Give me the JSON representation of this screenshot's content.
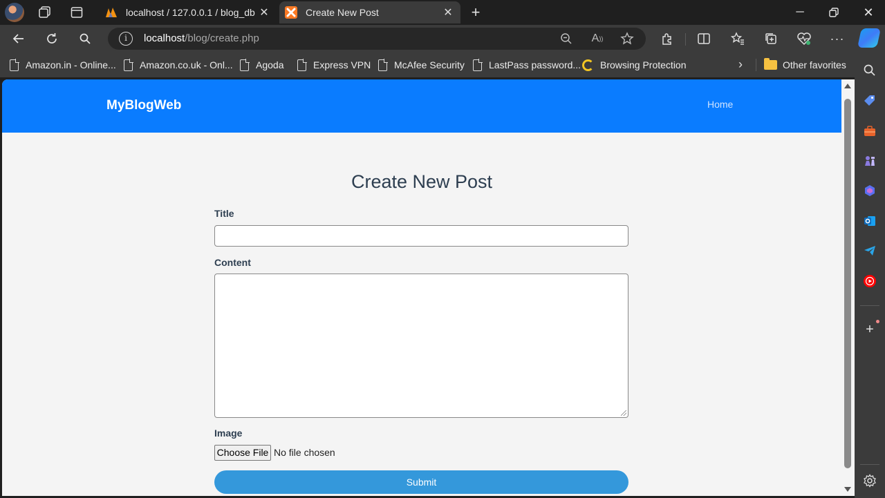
{
  "browser": {
    "tabs": [
      {
        "title": "localhost / 127.0.0.1 / blog_db / ",
        "favicon": "phpmyadmin-icon",
        "active": false
      },
      {
        "title": "Create New Post",
        "favicon": "xampp-icon",
        "active": true
      }
    ],
    "url": {
      "host": "localhost",
      "path": "/blog/create.php"
    },
    "favorites": [
      {
        "label": "Amazon.in - Online..."
      },
      {
        "label": "Amazon.co.uk - Onl..."
      },
      {
        "label": "Agoda"
      },
      {
        "label": "Express VPN"
      },
      {
        "label": "McAfee Security"
      },
      {
        "label": "LastPass password..."
      },
      {
        "label": "Browsing Protection"
      }
    ],
    "other_favorites": "Other favorites"
  },
  "site": {
    "brand": "MyBlogWeb",
    "nav_home": "Home",
    "header_color": "#0a7cff"
  },
  "form": {
    "heading": "Create New Post",
    "title_label": "Title",
    "title_value": "",
    "content_label": "Content",
    "content_value": "",
    "image_label": "Image",
    "file_button": "Choose File",
    "file_status": "No file chosen",
    "submit_label": "Submit",
    "submit_color": "#3498db"
  }
}
